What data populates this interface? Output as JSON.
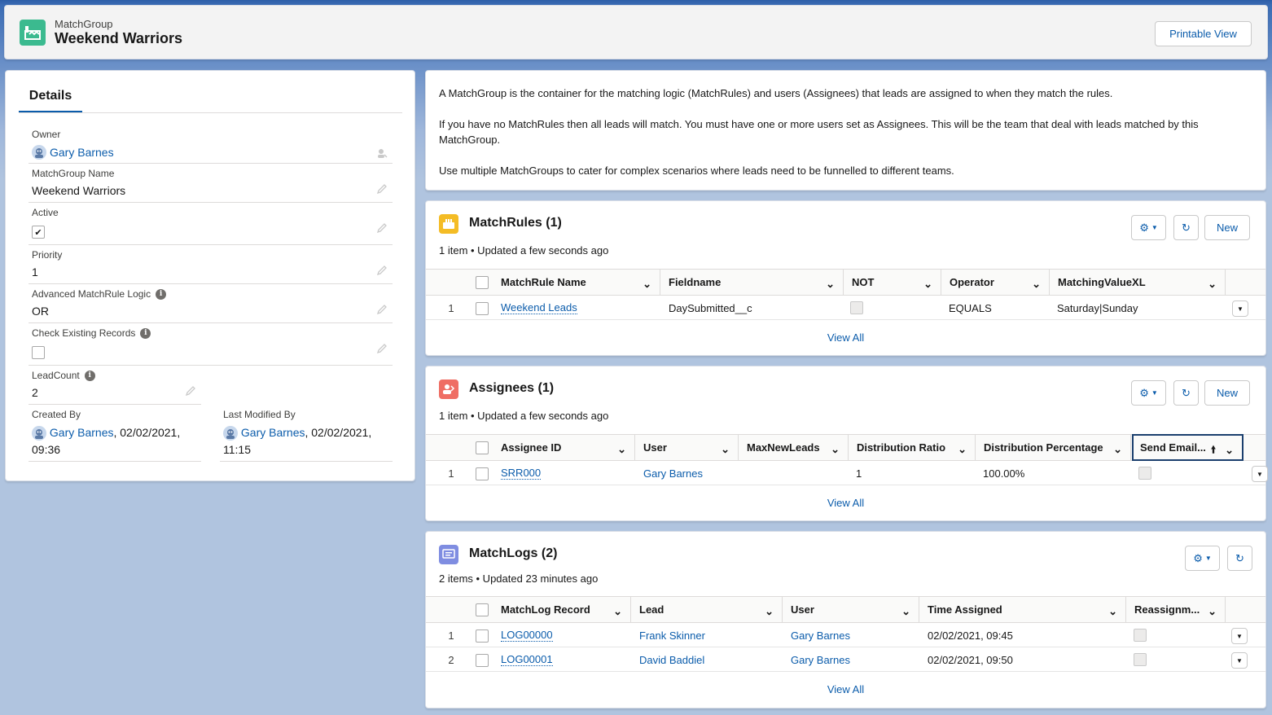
{
  "header": {
    "object_type": "MatchGroup",
    "record_name": "Weekend Warriors",
    "printable_view": "Printable View"
  },
  "details": {
    "tab_label": "Details",
    "owner": {
      "label": "Owner",
      "value": "Gary Barnes"
    },
    "name": {
      "label": "MatchGroup Name",
      "value": "Weekend Warriors"
    },
    "active": {
      "label": "Active",
      "checked": true
    },
    "priority": {
      "label": "Priority",
      "value": "1"
    },
    "advanced_logic": {
      "label": "Advanced MatchRule Logic",
      "value": "OR"
    },
    "check_existing": {
      "label": "Check Existing Records",
      "checked": false
    },
    "lead_count": {
      "label": "LeadCount",
      "value": "2"
    },
    "created_by": {
      "label": "Created By",
      "user": "Gary Barnes",
      "date": ", 02/02/2021,",
      "time": "09:36"
    },
    "modified_by": {
      "label": "Last Modified By",
      "user": "Gary Barnes",
      "date": ", 02/02/2021,",
      "time": "11:15"
    }
  },
  "help": {
    "p1": "A MatchGroup is the container for the matching logic (MatchRules) and users (Assignees) that leads are assigned to when they match the rules.",
    "p2": "If you have no MatchRules then all leads will match. You must have one or more users set as Assignees. This will be the team that deal with leads matched by this MatchGroup.",
    "p3": "Use multiple MatchGroups to cater for complex scenarios where leads need to be funnelled to different teams."
  },
  "match_rules": {
    "title": "MatchRules (1)",
    "subtitle": "1 item • Updated a few seconds ago",
    "new_label": "New",
    "columns": [
      "MatchRule Name",
      "Fieldname",
      "NOT",
      "Operator",
      "MatchingValueXL"
    ],
    "rows": [
      {
        "num": "1",
        "name": "Weekend Leads",
        "fieldname": "DaySubmitted__c",
        "operator": "EQUALS",
        "value": "Saturday|Sunday"
      }
    ],
    "view_all": "View All"
  },
  "assignees": {
    "title": "Assignees (1)",
    "subtitle": "1 item • Updated a few seconds ago",
    "new_label": "New",
    "columns": [
      "Assignee ID",
      "User",
      "MaxNewLeads",
      "Distribution Ratio",
      "Distribution Percentage",
      "Send Email..."
    ],
    "rows": [
      {
        "num": "1",
        "id": "SRR000",
        "user": "Gary Barnes",
        "max": "",
        "ratio": "1",
        "pct": "100.00%"
      }
    ],
    "view_all": "View All"
  },
  "match_logs": {
    "title": "MatchLogs (2)",
    "subtitle": "2 items • Updated 23 minutes ago",
    "columns": [
      "MatchLog Record",
      "Lead",
      "User",
      "Time Assigned",
      "Reassignm..."
    ],
    "rows": [
      {
        "num": "1",
        "record": "LOG00000",
        "lead": "Frank Skinner",
        "user": "Gary Barnes",
        "time": "02/02/2021, 09:45"
      },
      {
        "num": "2",
        "record": "LOG00001",
        "lead": "David Baddiel",
        "user": "Gary Barnes",
        "time": "02/02/2021, 09:50"
      }
    ],
    "view_all": "View All"
  },
  "colors": {
    "link": "#0b5cab",
    "app_icon": "#3bba8f",
    "match_rules_icon": "#f4bc25",
    "assignees_icon": "#ef6e64",
    "match_logs_icon": "#7f8de1"
  },
  "icons": [
    "app-icon",
    "pencil-icon",
    "info-icon",
    "gear-icon",
    "refresh-icon",
    "chevron-down-icon",
    "sort-up-icon",
    "avatar-icon"
  ]
}
